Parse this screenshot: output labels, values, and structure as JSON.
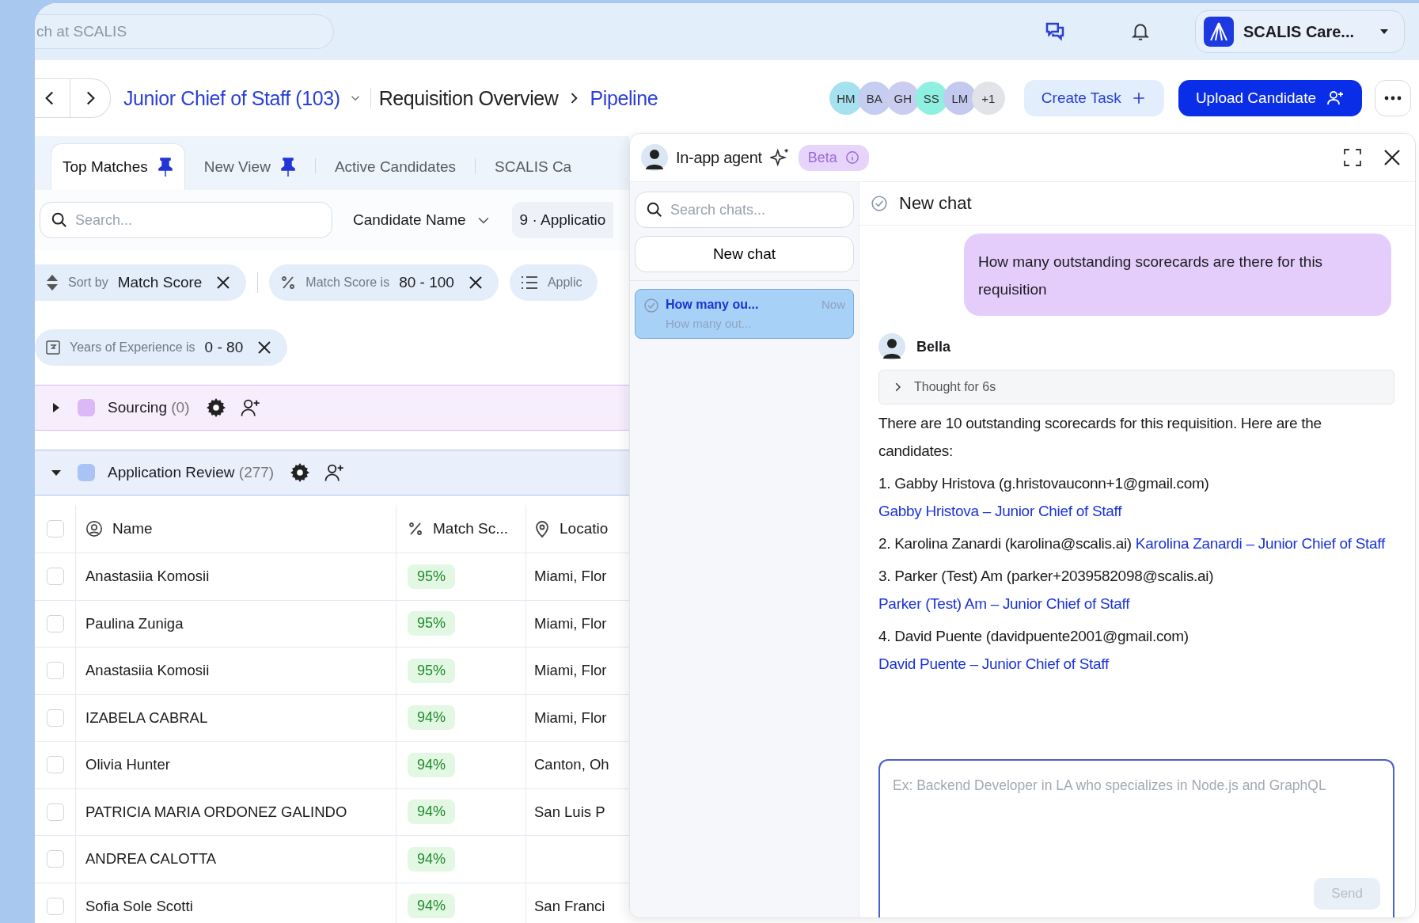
{
  "top_bar": {
    "search": {
      "placeholder": "ch at SCALIS"
    },
    "account": {
      "name": "SCALIS Care..."
    }
  },
  "header": {
    "job_title": "Junior Chief of Staff (103)",
    "breadcrumb": [
      {
        "label": "Requisition Overview",
        "current": false
      },
      {
        "label": "Pipeline",
        "current": true
      }
    ],
    "avatars": [
      {
        "initials": "HM",
        "color": "#a6e1f0"
      },
      {
        "initials": "BA",
        "color": "#c5cdf0"
      },
      {
        "initials": "GH",
        "color": "#cbcdf0"
      },
      {
        "initials": "SS",
        "color": "#8ff0e2"
      },
      {
        "initials": "LM",
        "color": "#c3c9ef"
      },
      {
        "initials": "+1",
        "color": "#e1e3e9"
      }
    ],
    "create_button": "Create Task",
    "upload_button": "Upload Candidate"
  },
  "view_tabs": [
    {
      "label": "Top Matches",
      "pinned": true,
      "selected": true
    },
    {
      "label": "New View",
      "pinned": true,
      "selected": false
    },
    {
      "label": "Active Candidates",
      "pinned": false,
      "selected": false
    },
    {
      "label": "SCALIS Ca",
      "pinned": false,
      "selected": false
    }
  ],
  "toolbar": {
    "search_placeholder": "Search...",
    "field_select": "Candidate Name",
    "stage_select": "9 · Applicatio"
  },
  "filter_chips": [
    {
      "kind": "sort",
      "label": "Sort by",
      "value": "Match Score",
      "removable": true
    },
    {
      "kind": "percent",
      "label": "Match Score is",
      "value": "80 - 100",
      "removable": true
    },
    {
      "kind": "list",
      "label": "Applic",
      "removable": false
    },
    {
      "kind": "years",
      "label": "Years of Experience is",
      "value": "0 - 80",
      "removable": true
    }
  ],
  "stages": [
    {
      "name": "Sourcing",
      "count": "(0)",
      "expanded": false,
      "color": "#dab9f6"
    },
    {
      "name": "Application Review",
      "count": "(277)",
      "expanded": true,
      "color": "#a9c3f5"
    }
  ],
  "table": {
    "select_all_checked": false,
    "columns": [
      "Name",
      "Match Sc...",
      "Locatio"
    ],
    "rows": [
      {
        "name": "Anastasiia Komosii",
        "match": "95%",
        "location": "Miami, Flor",
        "checked": false
      },
      {
        "name": "Paulina Zuniga",
        "match": "95%",
        "location": "Miami, Flor",
        "checked": false
      },
      {
        "name": "Anastasiia Komosii",
        "match": "95%",
        "location": "Miami, Flor",
        "checked": false
      },
      {
        "name": "IZABELA CABRAL",
        "match": "94%",
        "location": "Miami, Flor",
        "checked": false
      },
      {
        "name": "Olivia Hunter",
        "match": "94%",
        "location": "Canton, Oh",
        "checked": false
      },
      {
        "name": "PATRICIA MARIA ORDONEZ GALINDO",
        "match": "94%",
        "location": "San Luis P",
        "checked": false
      },
      {
        "name": "ANDREA CALOTTA",
        "match": "94%",
        "location": "",
        "checked": false
      },
      {
        "name": "Sofia Sole Scotti",
        "match": "94%",
        "location": "San Franci",
        "checked": false
      }
    ]
  },
  "agent": {
    "title": "In-app agent",
    "badge": "Beta",
    "search_placeholder": "Search chats...",
    "new_chat_button": "New chat",
    "chats": [
      {
        "title": "How many ou...",
        "preview": "How many out...",
        "time": "Now",
        "selected": true
      }
    ],
    "conversation_title": "New chat",
    "user_message": "How many outstanding scorecards are there for this requisition",
    "reply": {
      "author": "Bella",
      "thought": "Thought for 6s",
      "thought_expanded": false,
      "intro": "There are 10 outstanding scorecards for this requisition. Here are the candidates:",
      "items": [
        {
          "text": "1. Gabby Hristova (g.hristovauconn+1@gmail.com)",
          "link": "Gabby Hristova – Junior Chief of Staff"
        },
        {
          "text": "2. Karolina Zanardi (karolina@scalis.ai)",
          "link": "Karolina Zanardi – Junior Chief of Staff"
        },
        {
          "text": "3. Parker (Test) Am (parker+2039582098@scalis.ai)",
          "link": "Parker (Test) Am – Junior Chief of Staff"
        },
        {
          "text": "4. David Puente (davidpuente2001@gmail.com)",
          "link": "David Puente – Junior Chief of Staff"
        }
      ]
    },
    "composer": {
      "placeholder": "Ex: Backend Developer in LA who specializes in Node.js and GraphQL",
      "send": "Send",
      "send_disabled": true
    }
  }
}
